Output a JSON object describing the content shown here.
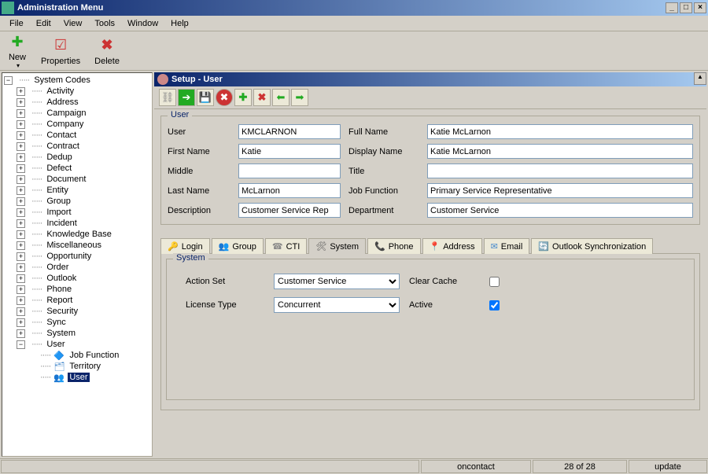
{
  "window": {
    "title": "Administration Menu"
  },
  "menu": {
    "file": "File",
    "edit": "Edit",
    "view": "View",
    "tools": "Tools",
    "window": "Window",
    "help": "Help"
  },
  "toolbar": {
    "new": "New",
    "properties": "Properties",
    "delete": "Delete"
  },
  "tree": {
    "root": "System Codes",
    "items": [
      "Activity",
      "Address",
      "Campaign",
      "Company",
      "Contact",
      "Contract",
      "Dedup",
      "Defect",
      "Document",
      "Entity",
      "Group",
      "Import",
      "Incident",
      "Knowledge Base",
      "Miscellaneous",
      "Opportunity",
      "Order",
      "Outlook",
      "Phone",
      "Report",
      "Security",
      "Sync",
      "System",
      "User"
    ],
    "user_children": {
      "job_function": "Job Function",
      "territory": "Territory",
      "user": "User"
    }
  },
  "setup": {
    "title": "Setup - User",
    "legend": "User",
    "labels": {
      "user": "User",
      "full_name": "Full Name",
      "first_name": "First Name",
      "display_name": "Display Name",
      "middle": "Middle",
      "title": "Title",
      "last_name": "Last Name",
      "job_function": "Job Function",
      "description": "Description",
      "department": "Department"
    },
    "values": {
      "user": "KMCLARNON",
      "full_name": "Katie McLarnon",
      "first_name": "Katie",
      "display_name": "Katie McLarnon",
      "middle": "",
      "title": "",
      "last_name": "McLarnon",
      "job_function": "Primary Service Representative",
      "description": "Customer Service Rep",
      "department": "Customer Service"
    }
  },
  "tabs": {
    "login": "Login",
    "group": "Group",
    "cti": "CTI",
    "system": "System",
    "phone": "Phone",
    "address": "Address",
    "email": "Email",
    "outlook": "Outlook Synchronization"
  },
  "system_panel": {
    "legend": "System",
    "action_set_label": "Action Set",
    "action_set_value": "Customer Service",
    "license_type_label": "License Type",
    "license_type_value": "Concurrent",
    "clear_cache_label": "Clear Cache",
    "clear_cache_checked": false,
    "active_label": "Active",
    "active_checked": true
  },
  "status": {
    "user": "oncontact",
    "count": "28 of 28",
    "mode": "update"
  }
}
